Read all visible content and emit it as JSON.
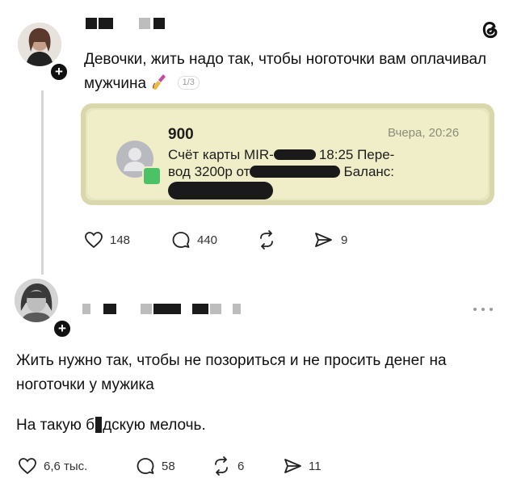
{
  "post1": {
    "text": "Девочки, жить надо так, чтобы ноготочки вам оплачивал мужчина",
    "image_counter": "1/3",
    "notification": {
      "sender": "900",
      "time": "Вчера, 20:26",
      "line1_a": "Счёт карты MIR-",
      "line1_b": "18:25 Пере-",
      "line2_a": "вод 3200р от",
      "line2_b": "Баланс:"
    },
    "actions": {
      "likes": "148",
      "comments": "440",
      "shares": "9"
    }
  },
  "post2": {
    "text1": "Жить нужно так, чтобы не позориться и не просить денег на ноготочки у мужика",
    "text2_a": "На такую б",
    "text2_b": "дскую мелочь.",
    "actions": {
      "likes": "6,6 тыс.",
      "comments": "58",
      "reposts": "6",
      "shares": "11"
    }
  },
  "icons": {
    "logo": "threads-logo-icon",
    "more": "more-icon",
    "like": "heart-icon",
    "comment": "comment-icon",
    "repost": "repost-icon",
    "share": "send-icon"
  }
}
